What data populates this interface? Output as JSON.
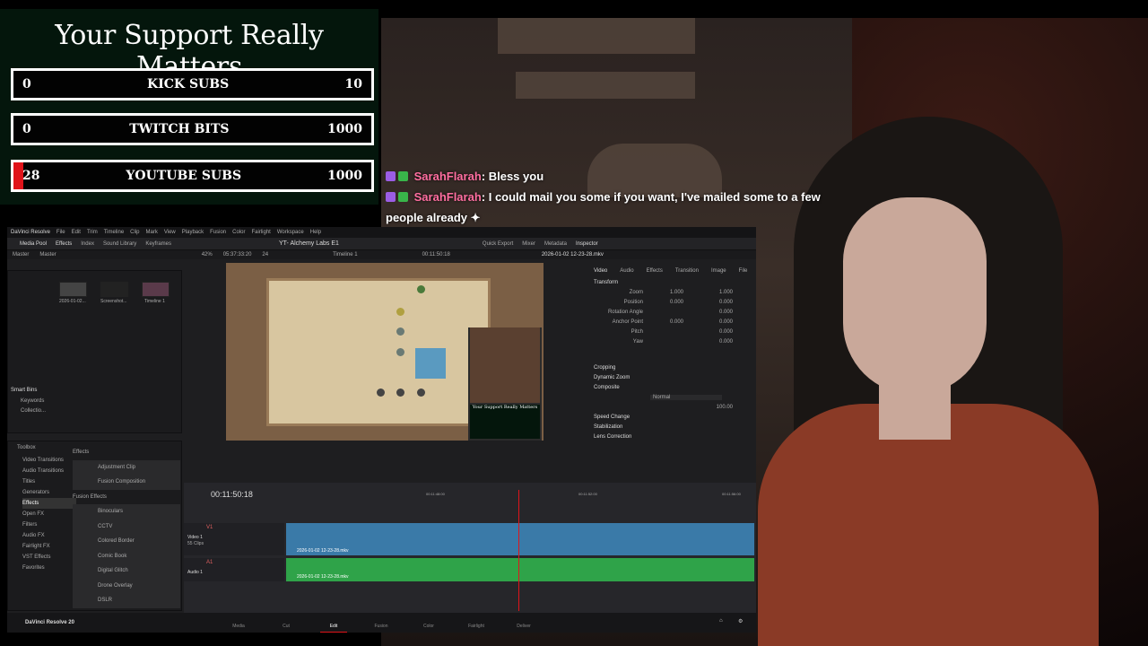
{
  "support": {
    "title": "Your Support Really Matters",
    "goals": [
      {
        "current": "0",
        "label": "KICK SUBS",
        "target": "10",
        "progress": 0
      },
      {
        "current": "0",
        "label": "TWITCH BITS",
        "target": "1000",
        "progress": 0
      },
      {
        "current": "28",
        "label": "YOUTUBE SUBS",
        "target": "1000",
        "progress": 0.028
      }
    ]
  },
  "chat": [
    {
      "user": "SarahFlarah",
      "text": ": Bless you"
    },
    {
      "user": "SarahFlarah",
      "text": ": I could mail you some if you want, I've mailed some to a few people already"
    }
  ],
  "resolve": {
    "app_title": "DaVinci Resolve",
    "menus": [
      "File",
      "Edit",
      "Trim",
      "Timeline",
      "Clip",
      "Mark",
      "View",
      "Playback",
      "Fusion",
      "Color",
      "Fairlight",
      "Workspace",
      "Help"
    ],
    "toolbar": [
      "Media Pool",
      "Effects",
      "Index",
      "Sound Library",
      "Keyframes"
    ],
    "project": "YT- Alchemy Labs E1",
    "right_toolbar": [
      "Quick Export",
      "Mixer",
      "Metadata",
      "Inspector"
    ],
    "bins": {
      "master": "Master",
      "master2": "Master",
      "smart_bins": "Smart Bins",
      "keywords": "Keywords",
      "collections": "Collectio..."
    },
    "clips": [
      "2026-01-02...",
      "Screenshot...",
      "Timeline 1"
    ],
    "viewer": {
      "zoom": "42%",
      "tc_left": "05:37:33:20",
      "fps": "24",
      "timeline": "Timeline 1",
      "tc_right": "00:11:50:18",
      "file": "2026-01-02 12-23-28.mkv"
    },
    "inspector": {
      "tabs": [
        "Video",
        "Audio",
        "Effects",
        "Transition",
        "Image",
        "File"
      ],
      "sections": [
        "Transform",
        "Cropping",
        "Dynamic Zoom",
        "Composite",
        "Speed Change",
        "Stabilization",
        "Lens Correction"
      ],
      "rows": [
        {
          "l": "Zoom",
          "x": "1.000",
          "y": "1.000"
        },
        {
          "l": "Position",
          "x": "0.000",
          "y": "0.000"
        },
        {
          "l": "Rotation Angle",
          "x": "",
          "y": "0.000"
        },
        {
          "l": "Anchor Point",
          "x": "0.000",
          "y": "0.000"
        },
        {
          "l": "Pitch",
          "x": "",
          "y": "0.000"
        },
        {
          "l": "Yaw",
          "x": "",
          "y": "0.000"
        }
      ],
      "composite_mode": "Normal",
      "opacity": "100.00"
    },
    "effects": {
      "toolbox": "Toolbox",
      "items": [
        "Video Transitions",
        "Audio Transitions",
        "Titles",
        "Generators",
        "Effects",
        "Open FX",
        "Filters",
        "Audio FX",
        "Fairlight FX",
        "VST Effects",
        "Favorites"
      ],
      "header": "Effects",
      "list": [
        "Adjustment Clip",
        "Fusion Composition"
      ],
      "fusion_header": "Fusion Effects",
      "fusion": [
        "Binoculars",
        "CCTV",
        "Colored Border",
        "Comic Book",
        "Digital Glitch",
        "Drone Overlay",
        "DSLR"
      ]
    },
    "timecode": "00:11:50:18",
    "ruler": [
      "00:11:48:00",
      "00:11:52:00",
      "00:11:56:00"
    ],
    "tracks": {
      "v1": "V1",
      "v1_name": "Video 1",
      "v1_clips": "55 Clips",
      "a1": "A1",
      "a1_name": "Audio 1",
      "clip_name": "2026-01-02 12-23-28.mkv"
    },
    "pages": [
      "Media",
      "Cut",
      "Edit",
      "Fusion",
      "Color",
      "Fairlight",
      "Deliver"
    ],
    "version": "DaVinci Resolve 20"
  }
}
